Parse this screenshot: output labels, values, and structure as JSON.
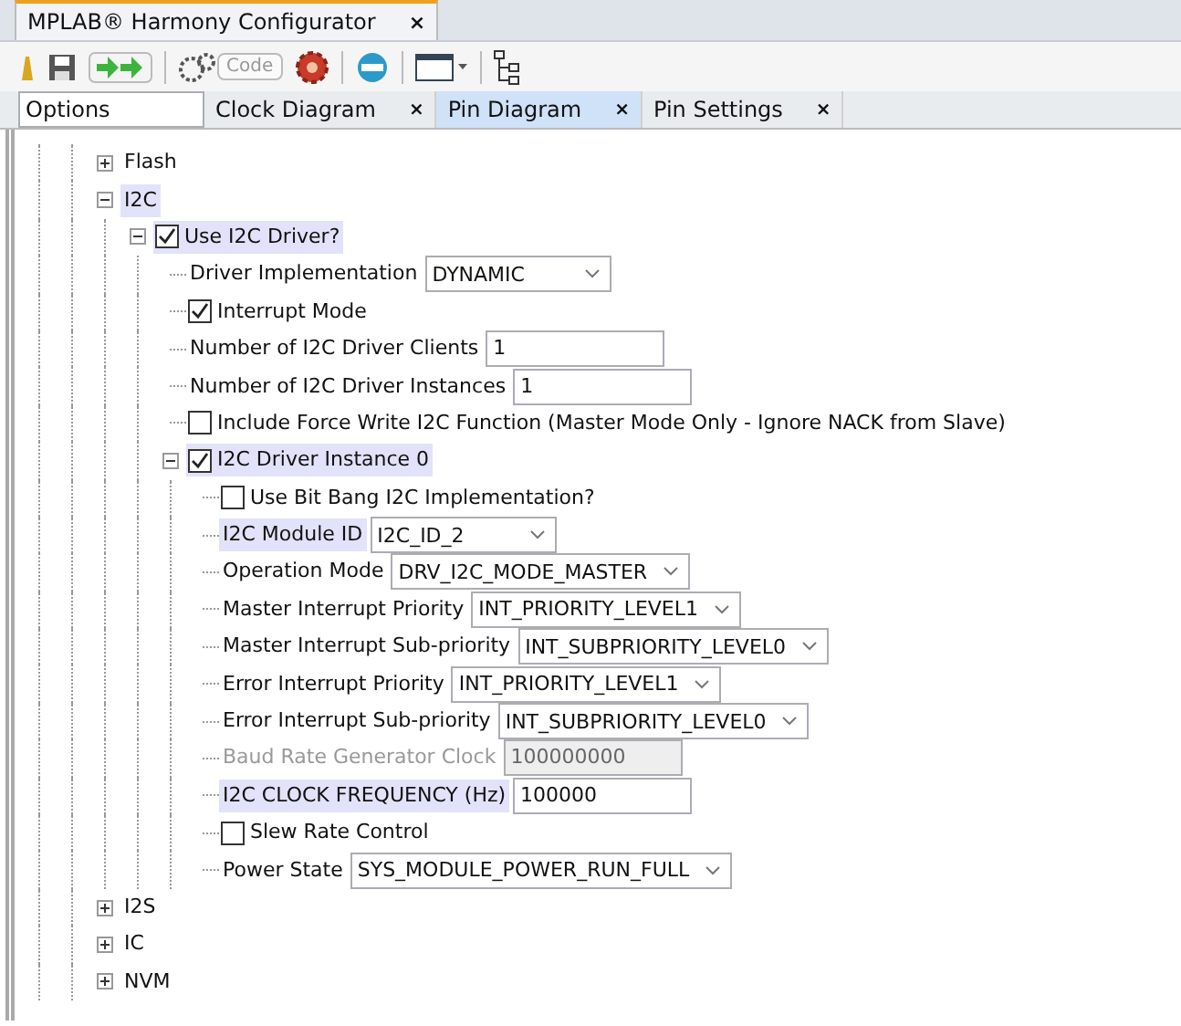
{
  "window_tab": {
    "title": "MPLAB® Harmony Configurator",
    "close": "×"
  },
  "toolbar": {
    "code_button": "Code"
  },
  "tabs": [
    {
      "label": "Options",
      "selected": true,
      "highlighted": false
    },
    {
      "label": "Clock Diagram",
      "selected": false,
      "highlighted": false,
      "close": "×"
    },
    {
      "label": "Pin Diagram",
      "selected": false,
      "highlighted": true,
      "close": "×"
    },
    {
      "label": "Pin Settings",
      "selected": false,
      "highlighted": false,
      "close": "×"
    }
  ],
  "tree": [
    {
      "kind": "branch",
      "label": "Flash",
      "expanded": false,
      "highlighted": false
    },
    {
      "kind": "branch",
      "label": "I2C",
      "expanded": true,
      "highlighted": true,
      "children": [
        {
          "kind": "check",
          "label": "Use I2C Driver?",
          "checked": true,
          "expanded": true,
          "highlighted": true,
          "children": [
            {
              "kind": "select",
              "label": "Driver Implementation",
              "value": "DYNAMIC",
              "highlighted": false
            },
            {
              "kind": "check",
              "label": "Interrupt Mode",
              "checked": true,
              "highlighted": false
            },
            {
              "kind": "text",
              "label": "Number of I2C Driver Clients",
              "value": "1",
              "disabled": false,
              "highlighted": false
            },
            {
              "kind": "text",
              "label": "Number of I2C Driver Instances",
              "value": "1",
              "disabled": false,
              "highlighted": false
            },
            {
              "kind": "check",
              "label": "Include Force Write I2C Function (Master Mode Only - Ignore NACK from Slave)",
              "checked": false,
              "highlighted": false
            },
            {
              "kind": "check",
              "label": "I2C Driver Instance 0",
              "checked": true,
              "expanded": true,
              "highlighted": true,
              "children": [
                {
                  "kind": "check",
                  "label": "Use Bit Bang I2C Implementation?",
                  "checked": false,
                  "highlighted": false
                },
                {
                  "kind": "select",
                  "label": "I2C Module ID",
                  "value": "I2C_ID_2",
                  "highlighted": true
                },
                {
                  "kind": "select",
                  "label": "Operation Mode",
                  "value": "DRV_I2C_MODE_MASTER",
                  "highlighted": false
                },
                {
                  "kind": "select",
                  "label": "Master Interrupt Priority",
                  "value": "INT_PRIORITY_LEVEL1",
                  "highlighted": false
                },
                {
                  "kind": "select",
                  "label": "Master Interrupt Sub-priority",
                  "value": "INT_SUBPRIORITY_LEVEL0",
                  "highlighted": false
                },
                {
                  "kind": "select",
                  "label": "Error Interrupt Priority",
                  "value": "INT_PRIORITY_LEVEL1",
                  "highlighted": false
                },
                {
                  "kind": "select",
                  "label": "Error Interrupt Sub-priority",
                  "value": "INT_SUBPRIORITY_LEVEL0",
                  "highlighted": false
                },
                {
                  "kind": "text",
                  "label": "Baud Rate Generator Clock",
                  "value": "100000000",
                  "disabled": true,
                  "highlighted": false
                },
                {
                  "kind": "text",
                  "label": "I2C CLOCK FREQUENCY (Hz)",
                  "value": "100000",
                  "disabled": false,
                  "highlighted": true
                },
                {
                  "kind": "check",
                  "label": "Slew Rate Control",
                  "checked": false,
                  "highlighted": false
                },
                {
                  "kind": "select",
                  "label": "Power State",
                  "value": "SYS_MODULE_POWER_RUN_FULL",
                  "highlighted": false
                }
              ]
            }
          ]
        }
      ]
    },
    {
      "kind": "branch",
      "label": "I2S",
      "expanded": false,
      "highlighted": false
    },
    {
      "kind": "branch",
      "label": "IC",
      "expanded": false,
      "highlighted": false
    },
    {
      "kind": "branch",
      "label": "NVM",
      "expanded": false,
      "highlighted": false
    }
  ]
}
